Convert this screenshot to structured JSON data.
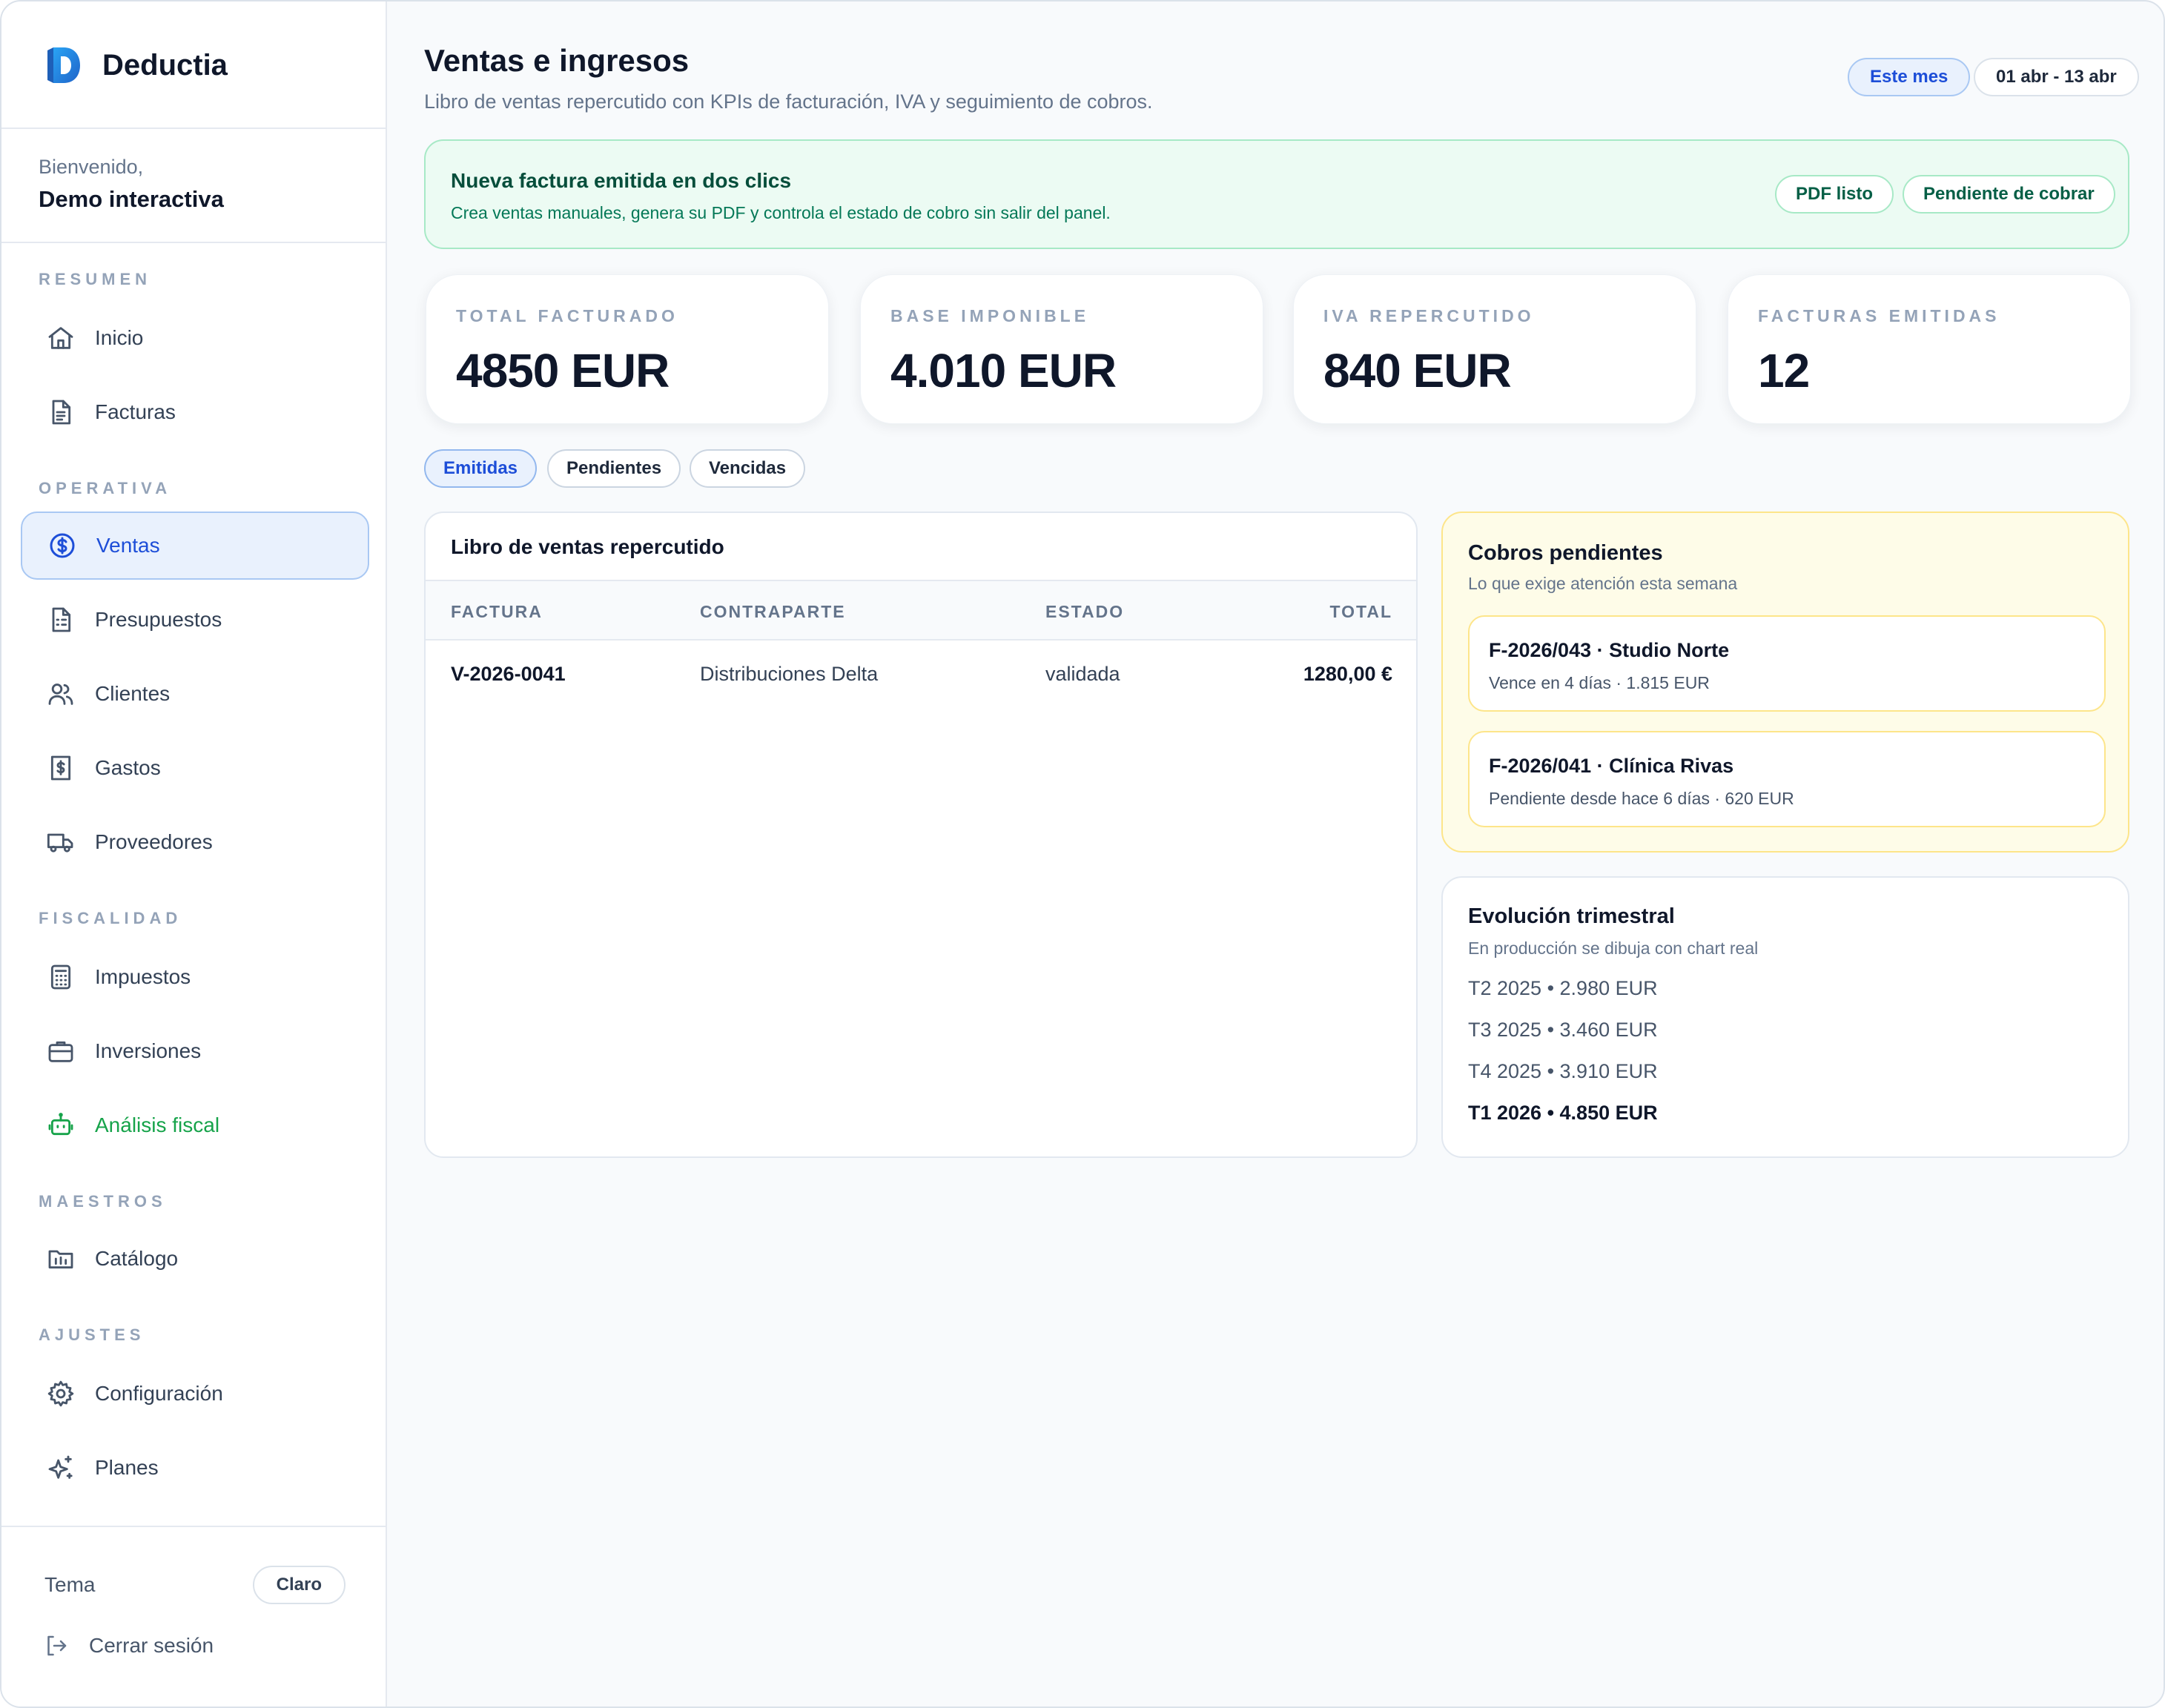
{
  "brand": {
    "name": "Deductia",
    "logo_icon": "deductia-logo-icon",
    "logo_color": "#1d7fd8"
  },
  "welcome": {
    "greeting": "Bienvenido,",
    "user": "Demo interactiva"
  },
  "sidebar": {
    "sections": [
      {
        "label": "RESUMEN",
        "items": [
          {
            "label": "Inicio",
            "icon": "home-icon"
          },
          {
            "label": "Facturas",
            "icon": "document-icon"
          }
        ]
      },
      {
        "label": "OPERATIVA",
        "items": [
          {
            "label": "Ventas",
            "icon": "dollar-circle-icon",
            "active": true
          },
          {
            "label": "Presupuestos",
            "icon": "quote-document-icon"
          },
          {
            "label": "Clientes",
            "icon": "users-icon"
          },
          {
            "label": "Gastos",
            "icon": "receipt-dollar-icon"
          },
          {
            "label": "Proveedores",
            "icon": "truck-icon"
          }
        ]
      },
      {
        "label": "FISCALIDAD",
        "items": [
          {
            "label": "Impuestos",
            "icon": "calculator-icon"
          },
          {
            "label": "Inversiones",
            "icon": "briefcase-icon"
          },
          {
            "label": "Análisis fiscal",
            "icon": "robot-icon",
            "accent": "#16a34a"
          }
        ]
      },
      {
        "label": "MAESTROS",
        "items": [
          {
            "label": "Catálogo",
            "icon": "catalog-folder-icon"
          }
        ]
      },
      {
        "label": "AJUSTES",
        "items": [
          {
            "label": "Configuración",
            "icon": "gear-icon"
          },
          {
            "label": "Planes",
            "icon": "sparkles-icon"
          }
        ]
      }
    ],
    "theme_label": "Tema",
    "theme_value": "Claro",
    "logout_label": "Cerrar sesión"
  },
  "header": {
    "title": "Ventas e ingresos",
    "subtitle": "Libro de ventas repercutido con KPIs de facturación, IVA y seguimiento de cobros.",
    "period_button": "Este mes",
    "date_range": "01 abr - 13 abr"
  },
  "banner": {
    "title": "Nueva factura emitida en dos clics",
    "text": "Crea ventas manuales, genera su PDF y controla el estado de cobro sin salir del panel.",
    "badges": [
      "PDF listo",
      "Pendiente de cobrar"
    ]
  },
  "kpis": [
    {
      "label": "TOTAL FACTURADO",
      "value": "4850 EUR"
    },
    {
      "label": "BASE IMPONIBLE",
      "value": "4.010 EUR"
    },
    {
      "label": "IVA REPERCUTIDO",
      "value": "840 EUR"
    },
    {
      "label": "FACTURAS EMITIDAS",
      "value": "12"
    }
  ],
  "filters": [
    {
      "label": "Emitidas",
      "active": true
    },
    {
      "label": "Pendientes"
    },
    {
      "label": "Vencidas"
    }
  ],
  "ledger": {
    "title": "Libro de ventas repercutido",
    "columns": [
      "FACTURA",
      "CONTRAPARTE",
      "ESTADO",
      "TOTAL"
    ],
    "rows": [
      {
        "factura": "V-2026-0041",
        "contraparte": "Distribuciones Delta",
        "estado": "validada",
        "total": "1280,00 €"
      }
    ]
  },
  "cobros": {
    "title": "Cobros pendientes",
    "subtitle": "Lo que exige atención esta semana",
    "items": [
      {
        "title": "F-2026/043 · Studio Norte",
        "detail": "Vence en 4 días · 1.815 EUR"
      },
      {
        "title": "F-2026/041 · Clínica Rivas",
        "detail": "Pendiente desde hace 6 días · 620 EUR"
      }
    ]
  },
  "evolucion": {
    "title": "Evolución trimestral",
    "subtitle": "En producción se dibuja con chart real",
    "rows": [
      "T2 2025 • 2.980 EUR",
      "T3 2025 • 3.460 EUR",
      "T4 2025 • 3.910 EUR",
      "T1 2026 • 4.850 EUR"
    ]
  }
}
